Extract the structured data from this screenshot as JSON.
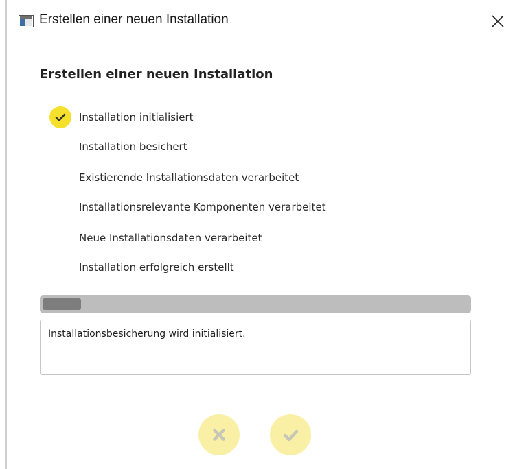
{
  "window": {
    "title": "Erstellen einer neuen Installation",
    "icon": "app-window-icon",
    "close_icon": "close-icon"
  },
  "heading": "Erstellen einer neuen Installation",
  "steps": [
    {
      "label": "Installation initialisiert",
      "done": true
    },
    {
      "label": "Installation besichert",
      "done": false
    },
    {
      "label": "Existierende Installationsdaten verarbeitet",
      "done": false
    },
    {
      "label": "Installationsrelevante Komponenten verarbeitet",
      "done": false
    },
    {
      "label": "Neue Installationsdaten verarbeitet",
      "done": false
    },
    {
      "label": "Installation erfolgreich erstellt",
      "done": false
    }
  ],
  "progress": {
    "fraction": 0.09
  },
  "log": {
    "text": "Installationsbesicherung wird initialisiert."
  },
  "buttons": {
    "cancel_icon": "cancel-x-icon",
    "confirm_icon": "confirm-check-icon",
    "enabled": false
  },
  "colors": {
    "accent_yellow": "#f5e12b",
    "button_yellow_disabled": "#faf0a5",
    "progress_track": "#bdbdbd",
    "progress_fill": "#7d7d7d"
  }
}
